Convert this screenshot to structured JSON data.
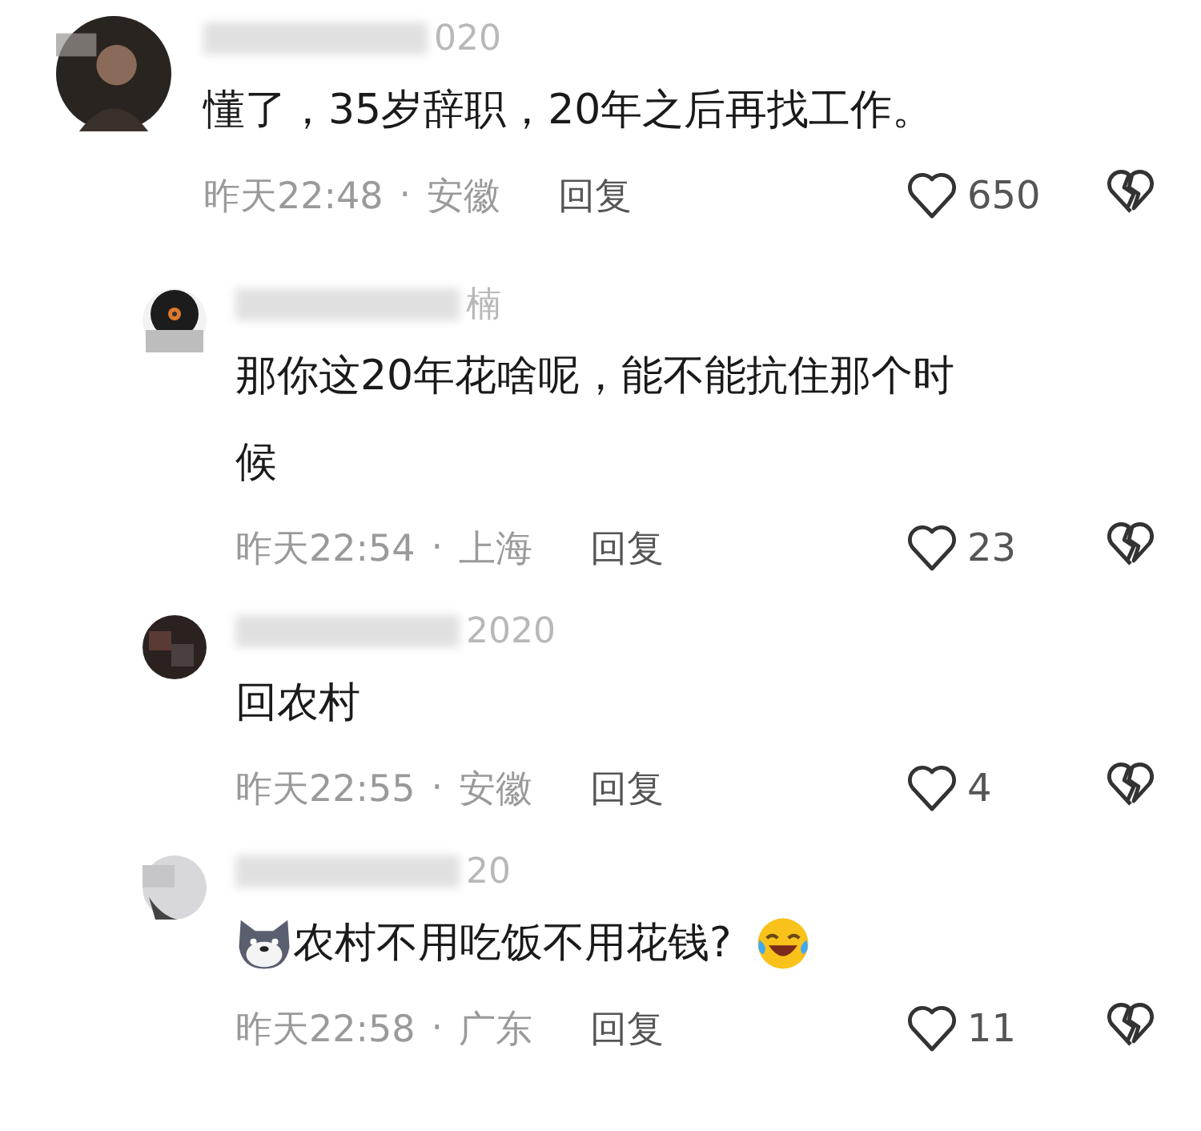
{
  "comments": [
    {
      "avatar": {
        "kind": "photo"
      },
      "name_fragment": "020",
      "text": "懂了，35岁辞职，20年之后再找工作。",
      "time": "昨天22:48",
      "separator": "·",
      "location": "安徽",
      "reply_label": "回复",
      "likes": "650",
      "leading_emoji": false,
      "trailing_emoji": false,
      "replies": [
        {
          "avatar": {
            "kind": "record"
          },
          "name_fragment": "楠",
          "text": "那你这20年花啥呢，能不能抗住那个时候",
          "time": "昨天22:54",
          "separator": "·",
          "location": "上海",
          "reply_label": "回复",
          "likes": "23",
          "leading_emoji": false,
          "trailing_emoji": false
        },
        {
          "avatar": {
            "kind": "dark"
          },
          "name_fragment": "2020",
          "text": "回农村",
          "time": "昨天22:55",
          "separator": "·",
          "location": "安徽",
          "reply_label": "回复",
          "likes": "4",
          "leading_emoji": false,
          "trailing_emoji": false
        },
        {
          "avatar": {
            "kind": "grey"
          },
          "name_fragment": "20",
          "text": "农村不用吃饭不用花钱?",
          "time": "昨天22:58",
          "separator": "·",
          "location": "广东",
          "reply_label": "回复",
          "likes": "11",
          "leading_emoji": true,
          "trailing_emoji": true
        }
      ]
    }
  ]
}
